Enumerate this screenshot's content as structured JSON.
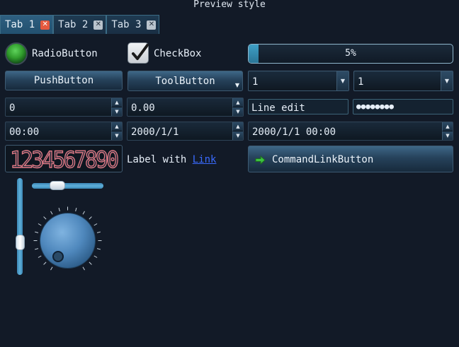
{
  "window": {
    "title": "Preview style"
  },
  "tabs": [
    {
      "label": "Tab 1",
      "active": true
    },
    {
      "label": "Tab 2",
      "active": false
    },
    {
      "label": "Tab 3",
      "active": false
    }
  ],
  "radio": {
    "label": "RadioButton",
    "checked": true
  },
  "checkbox": {
    "label": "CheckBox",
    "checked": true
  },
  "progress": {
    "value": 5,
    "text": "5%"
  },
  "buttons": {
    "push": "PushButton",
    "tool": "ToolButton"
  },
  "combos": [
    {
      "value": "1"
    },
    {
      "value": "1"
    }
  ],
  "spinboxes": {
    "int": "0",
    "double": "0.00",
    "time": "00:00",
    "date": "2000/1/1",
    "datetime": "2000/1/1 00:00"
  },
  "edits": {
    "text": "Line edit",
    "password": "●●●●●●●●"
  },
  "lcd": {
    "value": "1234567890"
  },
  "label": {
    "prefix": "Label with ",
    "link": "Link"
  },
  "command_link": {
    "label": "CommandLinkButton"
  },
  "sliders": {
    "vertical_value": 0.42,
    "horizontal_value": 0.35
  },
  "dial": {
    "value": 0.15
  },
  "colors": {
    "background": "#121a27",
    "accent": "#3fa0c6",
    "lcd": "#e07a86",
    "radio": "#3fb43a",
    "close": "#e5593e"
  }
}
